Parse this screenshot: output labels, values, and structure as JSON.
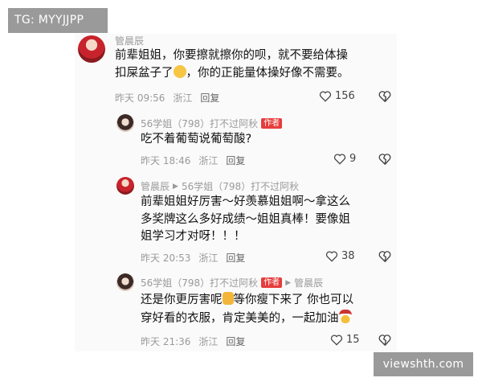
{
  "overlays": {
    "top_tag": "TG: MYYJJPP",
    "bottom_tag": "viewshth.com"
  },
  "comments": [
    {
      "user": "管晨辰",
      "line1": "前辈姐姐，你要擦就擦你的呗，就不要给体操",
      "line2a": "扣屎盆子了",
      "line2b": "，你的正能量体操好像不需要。",
      "emoji": "crying-face",
      "time": "昨天 09:56",
      "location": "浙江",
      "reply": "回复",
      "likes": "156"
    },
    {
      "user": "56学姐（798）打不过阿秋",
      "badge": "作者",
      "line1": "吃不着葡萄说葡萄酸?",
      "time": "昨天 18:46",
      "location": "浙江",
      "reply": "回复",
      "likes": "9"
    },
    {
      "user": "管晨辰",
      "reply_to": "56学姐（798）打不过阿秋",
      "line1": "前辈姐姐好厉害～好羡慕姐姐啊～拿这么",
      "line2": "多奖牌这么多好成绩～姐姐真棒！要像姐",
      "line3": "姐学习才对呀！！！",
      "time": "昨天 20:53",
      "location": "浙江",
      "reply": "回复",
      "likes": "38"
    },
    {
      "user": "56学姐（798）打不过阿秋",
      "badge": "作者",
      "reply_to": "管晨辰",
      "line1a": "还是你更厉害呢",
      "line1b": "等你瘦下来了 你也可以",
      "line2a": "穿好看的衣服，肯定美美的，一起加油",
      "emoji1": "thumbs-up",
      "emoji2": "medal",
      "time": "昨天 21:36",
      "location": "浙江",
      "reply": "回复",
      "likes": "15"
    }
  ]
}
